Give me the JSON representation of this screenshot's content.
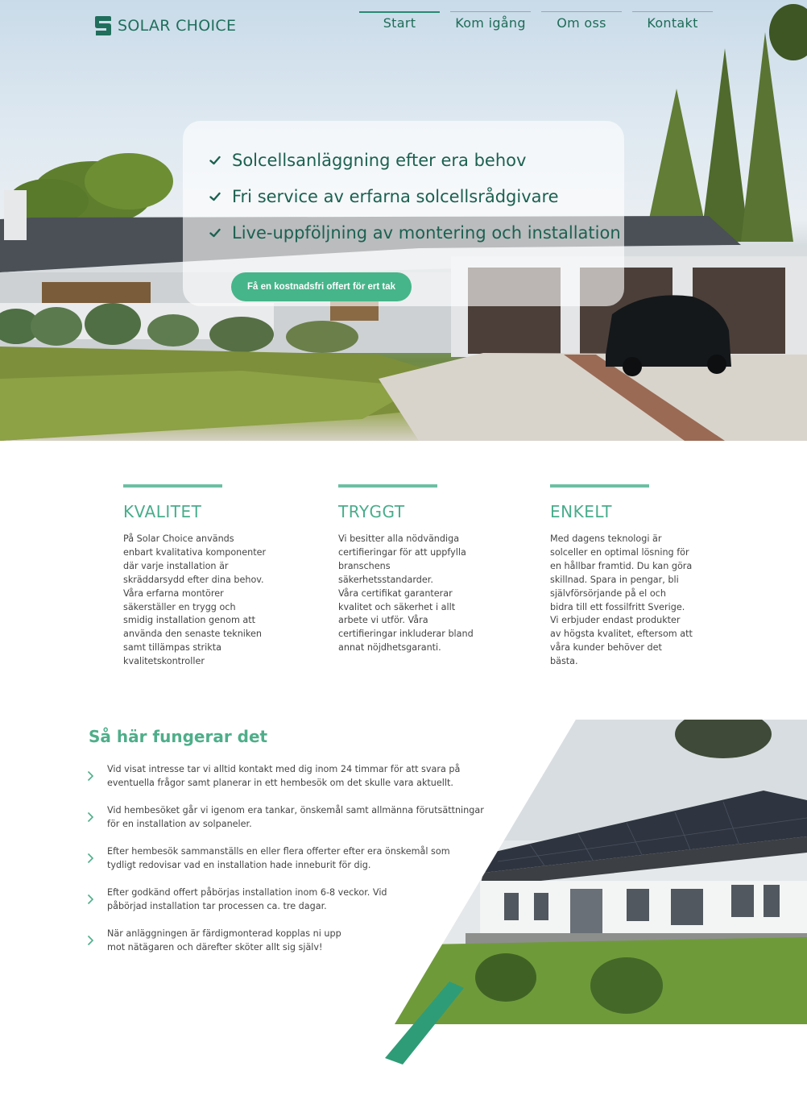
{
  "brand": {
    "name": "SOLAR CHOICE"
  },
  "nav": [
    {
      "label": "Start",
      "active": true
    },
    {
      "label": "Kom igång",
      "active": false
    },
    {
      "label": "Om oss",
      "active": false
    },
    {
      "label": "Kontakt",
      "active": false
    }
  ],
  "hero": {
    "features": [
      "Solcellsanläggning efter era behov",
      "Fri service av erfarna solcellsrådgivare",
      "Live-uppföljning av montering och installation"
    ],
    "cta_label": "Få en kostnadsfri offert för ert tak"
  },
  "columns": [
    {
      "title": "KVALITET",
      "text": "På Solar Choice används\nenbart kvalitativa komponenter\ndär varje installation är\nskräddarsydd efter dina behov.\nVåra erfarna montörer\nsäkerställer en trygg och\nsmidig installation genom att\nanvända den senaste tekniken\nsamt tillämpas strikta\nkvalitetskontroller"
    },
    {
      "title": "TRYGGT",
      "text": "Vi besitter alla nödvändiga\ncertifieringar för att uppfylla\nbranschens\nsäkerhetsstandarder.\nVåra certifikat garanterar\nkvalitet och säkerhet i allt\narbete vi utför. Våra\ncertifieringar inkluderar bland\nannat nöjdhetsgaranti."
    },
    {
      "title": "ENKELT",
      "text": "Med dagens teknologi är\nsolceller en optimal lösning för\nen hållbar framtid. Du kan göra\nskillnad. Spara in pengar, bli\nsjälvförsörjande på el och\nbidra till ett fossilfritt Sverige.\nVi erbjuder endast produkter\nav högsta kvalitet, eftersom att\nvåra kunder behöver det\nbästa."
    }
  ],
  "how": {
    "title": "Så här fungerar det",
    "steps": [
      "Vid visat intresse tar vi alltid kontakt med dig inom 24 timmar för att svara på\neventuella frågor samt planerar in ett hembesök om det skulle vara aktuellt.",
      "Vid hembesöket går vi igenom era tankar, önskemål samt allmänna förutsättningar\nför en installation av solpaneler.",
      "Efter hembesök sammanställs en eller flera offerter efter era önskemål som\ntydligt redovisar vad en installation hade inneburit för dig.",
      "Efter godkänd offert påbörjas installation inom 6-8 veckor. Vid\npåbörjad installation tar processen ca. tre dagar.",
      "När anläggningen är färdigmonterad kopplas ni upp\nmot nätägaren och därefter sköter allt sig själv!"
    ]
  },
  "colors": {
    "brand_dark": "#1f6f5c",
    "accent_green": "#46b58a",
    "heading_green": "#48ad8c"
  },
  "icons": {
    "logo": "solar-choice-s-logo",
    "feature_bullet": "check-icon",
    "step_bullet": "chevron-right-icon"
  }
}
